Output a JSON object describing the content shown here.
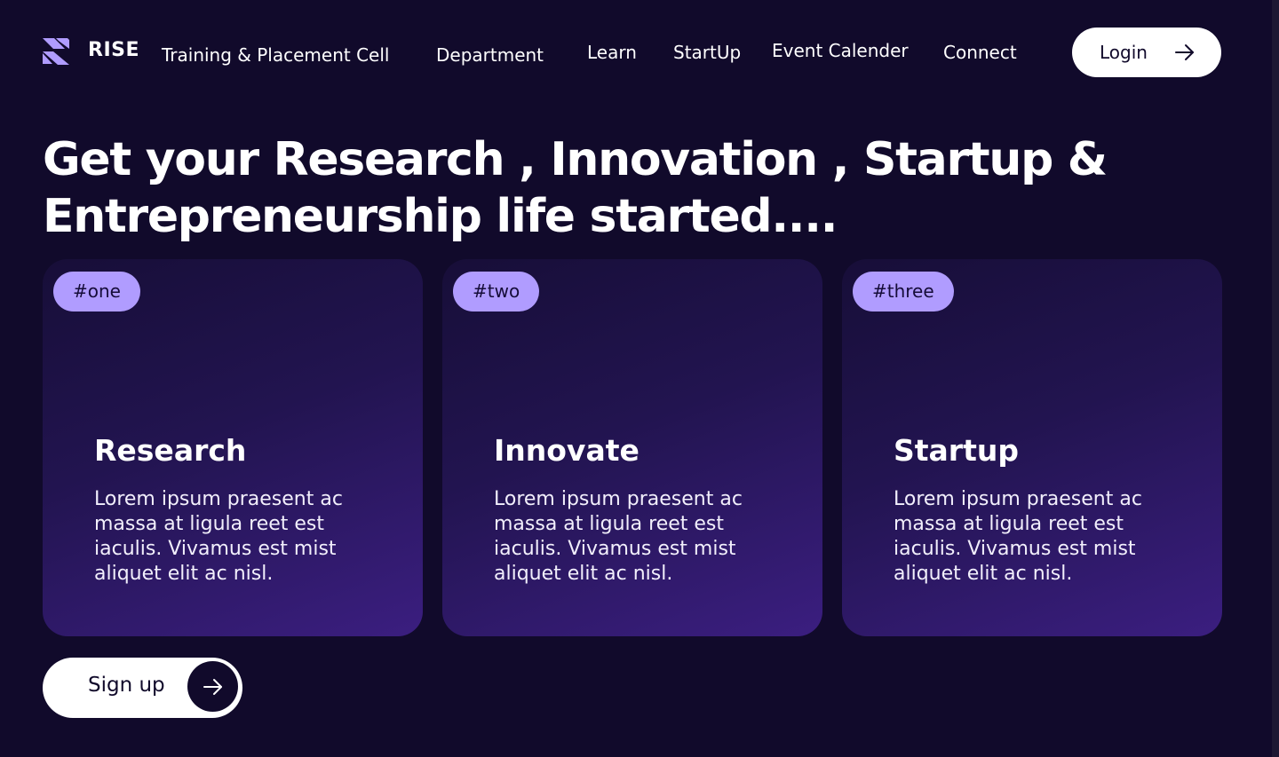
{
  "nav": {
    "brand": "RISE",
    "links": [
      "Training & Placement Cell",
      "Department",
      "Learn",
      "StartUp",
      "Event Calender",
      "Connect"
    ],
    "login_label": "Login",
    "login_icon": "arrow-right-icon"
  },
  "hero": {
    "line1": "Get your Research , Innovation , Startup &",
    "line2": "Entrepreneurship life started...."
  },
  "cards": [
    {
      "badge": "#one",
      "title": "Research",
      "text": "Lorem ipsum praesent ac massa at ligula reet est iaculis. Vivamus est mist aliquet elit ac nisl."
    },
    {
      "badge": "#two",
      "title": "Innovate",
      "text": "Lorem ipsum praesent ac massa at ligula reet est iaculis. Vivamus est mist aliquet elit ac nisl."
    },
    {
      "badge": "#three",
      "title": "Startup",
      "text": "Lorem ipsum praesent ac massa at ligula reet est iaculis. Vivamus est mist aliquet elit ac nisl."
    }
  ],
  "signup": {
    "label": "Sign up",
    "icon": "arrow-right-icon"
  },
  "colors": {
    "background": "#110a2b",
    "badge": "#b09cff",
    "card_gradient_start": "#170e38",
    "card_gradient_end": "#3b1e80",
    "button": "#ffffff",
    "logo": "#b09cff"
  }
}
